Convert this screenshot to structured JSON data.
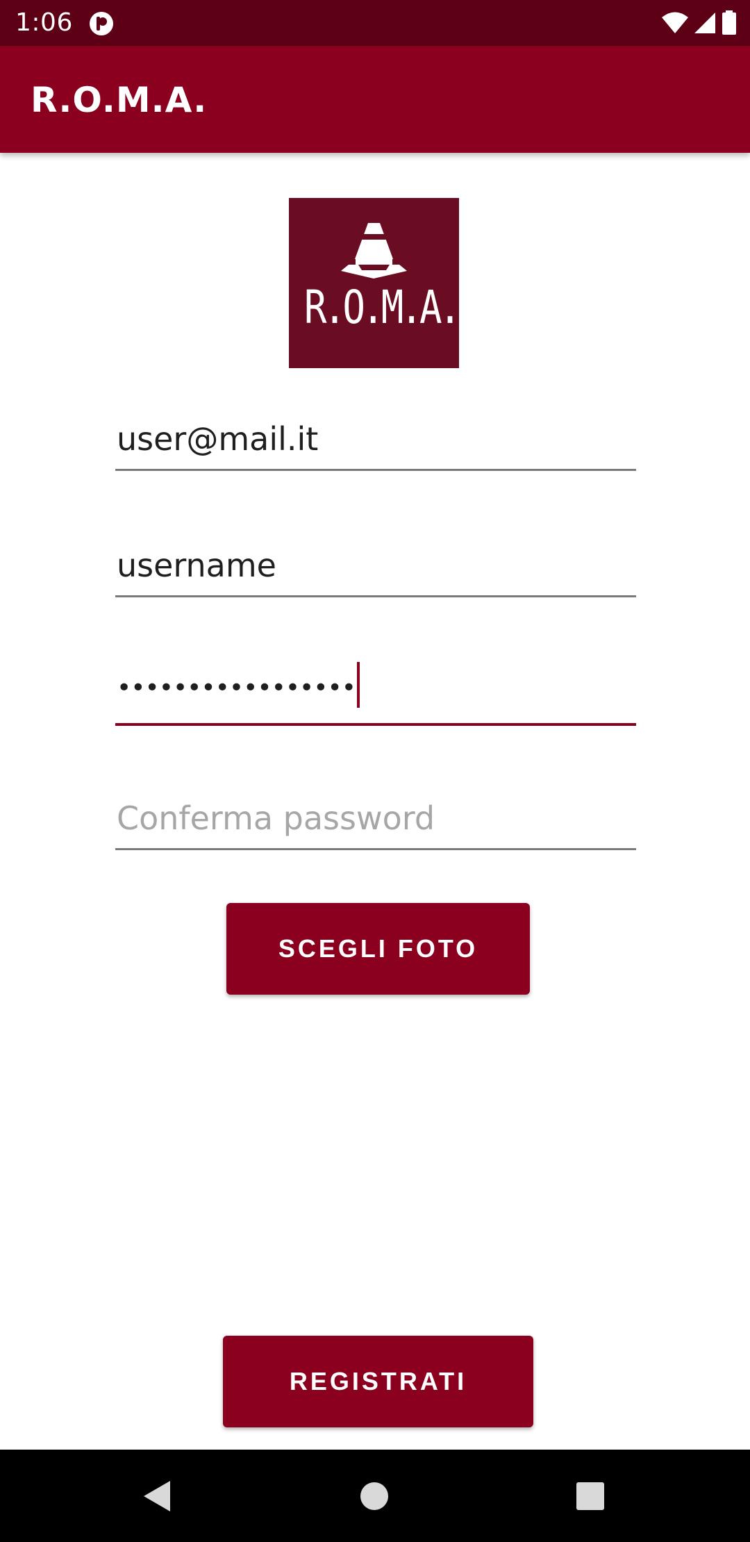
{
  "status_bar": {
    "time": "1:06",
    "icons": [
      "notification-icon",
      "wifi-icon",
      "signal-icon",
      "battery-icon"
    ]
  },
  "app_bar": {
    "title": "R.O.M.A."
  },
  "logo": {
    "text": "R.O.M.A.",
    "icon": "traffic-cone-icon"
  },
  "form": {
    "email": {
      "value": "user@mail.it"
    },
    "username": {
      "value": "username"
    },
    "password": {
      "value": "•••••••••••••••••"
    },
    "confirm_password": {
      "placeholder": "Conferma password"
    }
  },
  "buttons": {
    "choose_photo": "SCEGLI FOTO",
    "register": "REGISTRATI"
  },
  "nav": {
    "icons": [
      "back-icon",
      "home-icon",
      "recents-icon"
    ]
  },
  "colors": {
    "primary": "#8a001e",
    "primary_dark": "#5d0016",
    "logo_bg": "#6a0d22"
  }
}
